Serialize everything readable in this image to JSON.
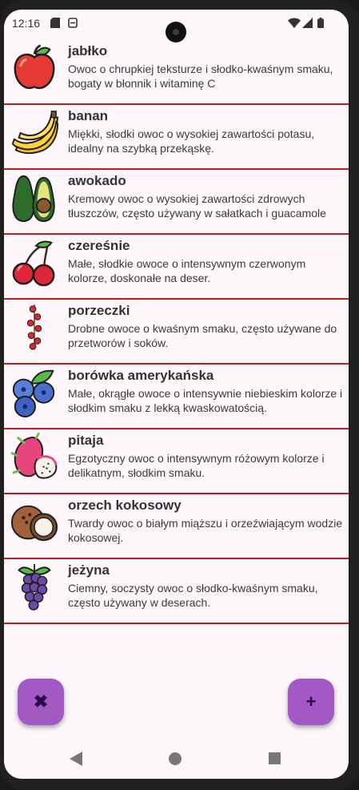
{
  "status_bar": {
    "time": "12:16"
  },
  "fruits": [
    {
      "name": "jabłko",
      "description": "Owoc o chrupkiej teksturze i słodko-kwaśnym smaku, bogaty w błonnik i witaminę C",
      "icon": "apple-icon"
    },
    {
      "name": "banan",
      "description": "Miękki, słodki owoc o wysokiej zawartości potasu, idealny na szybką przekąskę.",
      "icon": "banana-icon"
    },
    {
      "name": "awokado",
      "description": "Kremowy owoc o wysokiej zawartości zdrowych tłuszczów, często używany w sałatkach i guacamole",
      "icon": "avocado-icon"
    },
    {
      "name": "czereśnie",
      "description": "Małe, słodkie owoce o intensywnym czerwonym kolorze, doskonałe na deser.",
      "icon": "cherries-icon"
    },
    {
      "name": "porzeczki",
      "description": "Drobne owoce o kwaśnym smaku, często używane do przetworów i soków.",
      "icon": "currants-icon"
    },
    {
      "name": "borówka amerykańska",
      "description": "Małe, okrągłe owoce o intensywnie niebieskim kolorze i słodkim smaku z lekką kwaskowatością.",
      "icon": "blueberries-icon"
    },
    {
      "name": "pitaja",
      "description": "Egzotyczny owoc o intensywnym różowym kolorze i delikatnym, słodkim smaku.",
      "icon": "dragon-fruit-icon"
    },
    {
      "name": "orzech kokosowy",
      "description": "Twardy owoc o białym miąższu i orzeźwiającym wodzie kokosowej.",
      "icon": "coconut-icon"
    },
    {
      "name": "jeżyna",
      "description": "Ciemny, soczysty owoc o słodko-kwaśnym smaku, często używany w deserach.",
      "icon": "blackberry-icon"
    }
  ],
  "fab_clear": {
    "icon": "close-icon",
    "glyph": "✖"
  },
  "fab_add": {
    "icon": "plus-icon",
    "glyph": "+"
  },
  "colors": {
    "accent": "#a259c4",
    "divider": "#c21c1c",
    "background": "#fdf7fb"
  }
}
